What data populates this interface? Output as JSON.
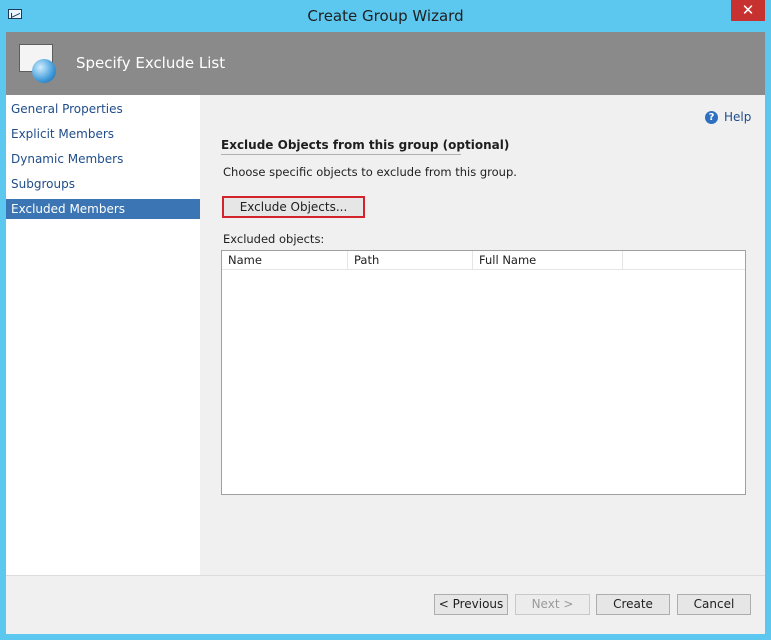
{
  "window": {
    "title": "Create Group Wizard",
    "close_glyph": "✕"
  },
  "header": {
    "title": "Specify Exclude List"
  },
  "nav": {
    "items": [
      {
        "label": "General Properties"
      },
      {
        "label": "Explicit Members"
      },
      {
        "label": "Dynamic Members"
      },
      {
        "label": "Subgroups"
      },
      {
        "label": "Excluded Members",
        "active": true
      }
    ]
  },
  "content": {
    "help_label": "Help",
    "section_title": "Exclude Objects from this group (optional)",
    "description": "Choose specific objects to exclude from this group.",
    "exclude_button": "Exclude Objects...",
    "excluded_label": "Excluded objects:",
    "columns": [
      "Name",
      "Path",
      "Full Name"
    ]
  },
  "footer": {
    "previous": "< Previous",
    "next": "Next >",
    "create": "Create",
    "cancel": "Cancel"
  },
  "colors": {
    "accent": "#3b75b3",
    "title_bar": "#5cc8ef",
    "header": "#8a8a8a",
    "highlight_border": "#d3242b",
    "close": "#c7312f"
  },
  "icons": {
    "system": "window-icon",
    "wizard": "group-wizard-icon",
    "help": "help-icon"
  }
}
